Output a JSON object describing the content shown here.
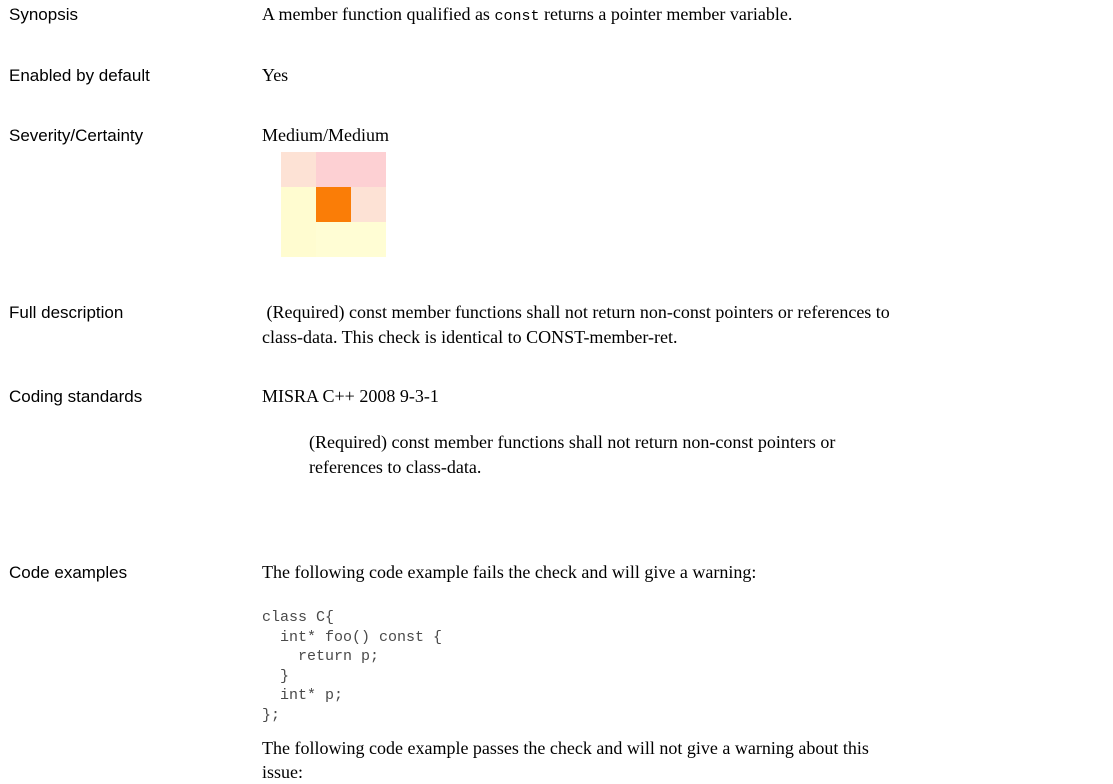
{
  "rows": {
    "synopsis": {
      "label": "Synopsis",
      "text_before": "A member function qualified as ",
      "code": "const",
      "text_after": " returns a pointer member variable."
    },
    "enabled": {
      "label": "Enabled by default",
      "value": "Yes"
    },
    "severity": {
      "label": "Severity/Certainty",
      "value": "Medium/Medium",
      "matrix_colors": [
        [
          "#fde2d5",
          "#fdd0d3",
          "#fdd0d3"
        ],
        [
          "#fffcd0",
          "#fa7d07",
          "#fde2d5"
        ],
        [
          "#fffcd0",
          "#fffdd4",
          "#fffdd4"
        ]
      ]
    },
    "description": {
      "label": "Full description",
      "line1": " (Required) const member functions shall not return non-const pointers or references to",
      "line2": "class-data. This check is identical to CONST-member-ret."
    },
    "coding": {
      "label": "Coding standards",
      "standard": "MISRA C++ 2008 9-3-1",
      "detail_line1": "(Required) const member functions shall not return non-const pointers or",
      "detail_line2": "references to class-data."
    },
    "examples": {
      "label": "Code examples",
      "fail_intro": "The following code example fails the check and will give a warning:",
      "fail_code": "class C{\n  int* foo() const {\n    return p;\n  }\n  int* p;\n};",
      "pass_intro_line1": "The following code example passes the check and will not give a warning about this",
      "pass_intro_line2": "issue:"
    }
  }
}
